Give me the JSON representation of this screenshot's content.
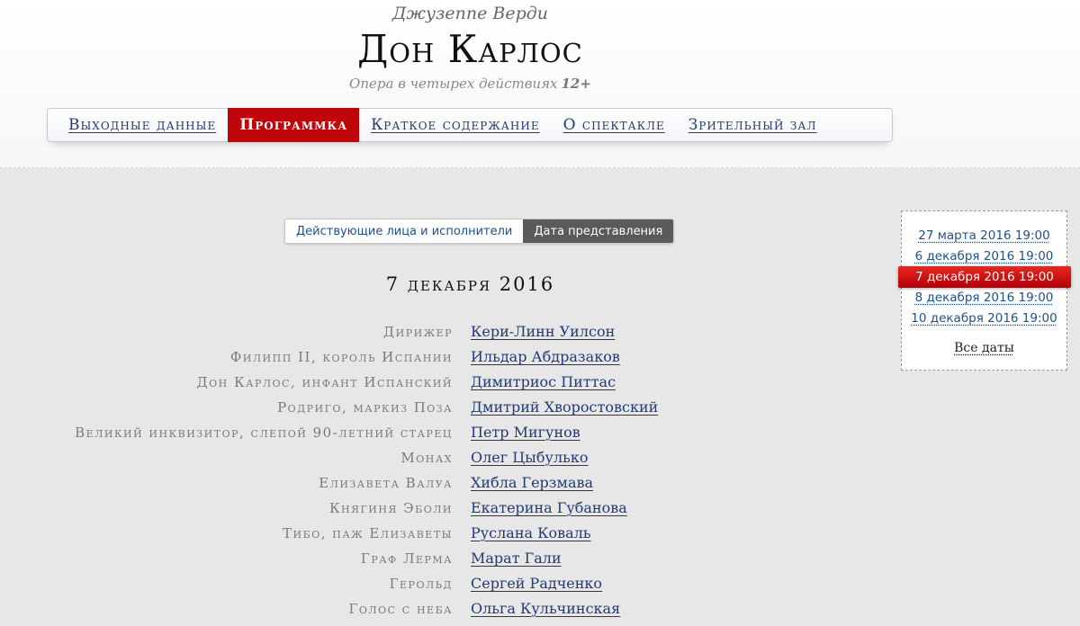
{
  "header": {
    "composer": "Джузеппе Верди",
    "title": "Дон Карлос",
    "subtitle": "Опера в четырех действиях",
    "age_rating": "12+"
  },
  "nav": {
    "items": [
      {
        "label": "Выходные данные",
        "active": false
      },
      {
        "label": "Программка",
        "active": true
      },
      {
        "label": "Краткое содержание",
        "active": false
      },
      {
        "label": "О спектакле",
        "active": false
      },
      {
        "label": "Зрительный зал",
        "active": false
      }
    ]
  },
  "subtabs": {
    "cast": "Действующие лица и исполнители",
    "date": "Дата представления"
  },
  "performance_date": "7 декабря 2016",
  "cast": [
    {
      "role": "Дирижер",
      "performer": "Кери-Линн Уилсон"
    },
    {
      "role": "Филипп II, король Испании",
      "performer": "Ильдар Абдразаков"
    },
    {
      "role": "Дон Карлос, инфант Испанский",
      "performer": "Димитриос Питтас"
    },
    {
      "role": "Родриго, маркиз Поза",
      "performer": "Дмитрий Хворостовский"
    },
    {
      "role": "Великий инквизитор, слепой 90-летний старец",
      "performer": "Петр Мигунов"
    },
    {
      "role": "Монах",
      "performer": "Олег Цыбулько"
    },
    {
      "role": "Елизавета Валуа",
      "performer": "Хибла Герзмава"
    },
    {
      "role": "Княгиня Эболи",
      "performer": "Екатерина Губанова"
    },
    {
      "role": "Тибо, паж Елизаветы",
      "performer": "Руслана Коваль"
    },
    {
      "role": "Граф Лерма",
      "performer": "Марат Гали"
    },
    {
      "role": "Герольд",
      "performer": "Сергей Радченко"
    },
    {
      "role": "Голос с неба",
      "performer": "Ольга Кульчинская"
    }
  ],
  "dates": {
    "items": [
      {
        "label": "27 марта 2016 19:00",
        "selected": false
      },
      {
        "label": "6 декабря 2016 19:00",
        "selected": false
      },
      {
        "label": "7 декабря 2016 19:00",
        "selected": true
      },
      {
        "label": "8 декабря 2016 19:00",
        "selected": false
      },
      {
        "label": "10 декабря 2016 19:00",
        "selected": false
      }
    ],
    "all_dates": "Все даты"
  },
  "colors": {
    "accent_red": "#c0050a",
    "link_blue": "#1f3c78"
  }
}
